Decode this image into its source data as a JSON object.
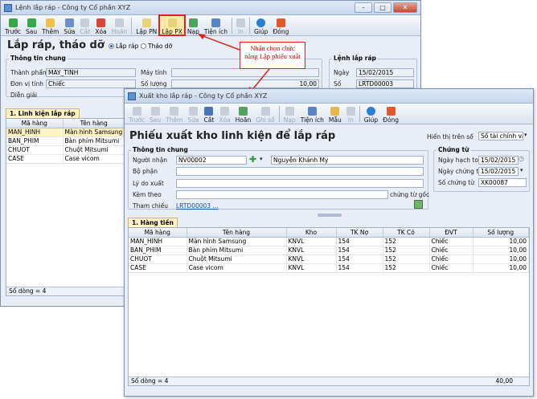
{
  "back": {
    "title": "Lệnh lắp ráp - Công ty Cổ phần XYZ",
    "toolbar": [
      "Trước",
      "Sau",
      "Thêm",
      "Sửa",
      "Cắt",
      "Xóa",
      "Hoãn",
      "Lập PN",
      "Lập PX",
      "Nạp",
      "Tiện ích",
      "In",
      "Giúp",
      "Đóng"
    ],
    "heading": "Lắp ráp, tháo dỡ",
    "radio_assemble": "Lắp ráp",
    "radio_disassemble": "Tháo dỡ",
    "group_general": "Thông tin chung",
    "lbl_product": "Thành phẩm",
    "val_product": "MAY_TINH",
    "lbl_product_name": "Máy tính",
    "lbl_unit": "Đơn vị tính",
    "val_unit": "Chiếc",
    "lbl_qty": "Số lượng",
    "val_qty": "10,00",
    "lbl_desc": "Diễn giải",
    "group_order": "Lệnh lắp ráp",
    "lbl_date": "Ngày",
    "val_date": "15/02/2015",
    "lbl_no": "Số",
    "val_no": "LRTD00003",
    "tab": "1. Linh kiện lắp ráp",
    "col_code": "Mã hàng",
    "col_name": "Tên hàng",
    "rows": [
      [
        "MAN_HINH",
        "Màn hình Samsung"
      ],
      [
        "BAN_PHIM",
        "Bàn phím Mitsumi"
      ],
      [
        "CHUOT",
        "Chuột Mitsumi"
      ],
      [
        "CASE",
        "Case vicom"
      ]
    ],
    "footer": "Số dòng = 4"
  },
  "callout": "Nhấn chọn chức năng Lập phiếu xuất",
  "front": {
    "title": "Xuất kho lắp ráp - Công ty Cổ phần XYZ",
    "toolbar": [
      "Trước",
      "Sau",
      "Thêm",
      "Sửa",
      "Cắt",
      "Xóa",
      "Hoãn",
      "Ghi sổ",
      "Nạp",
      "Tiện ích",
      "Mẫu",
      "In",
      "Giúp",
      "Đóng"
    ],
    "heading": "Phiếu xuất kho linh kiện để lắp ráp",
    "lbl_show": "Hiển thị trên sổ",
    "val_show": "Sổ tài chính và quản trị",
    "group_general": "Thông tin chung",
    "lbl_receiver": "Người nhận",
    "val_receiver_code": "NV00002",
    "val_receiver_name": "Nguyễn Khánh My",
    "lbl_dept": "Bộ phận",
    "lbl_reason": "Lý do xuất",
    "lbl_attach": "Kèm theo",
    "lbl_original": "chứng từ gốc",
    "lbl_ref": "Tham chiếu",
    "val_ref": "LRTD00003 ...",
    "group_voucher": "Chứng từ",
    "lbl_post_date": "Ngày hạch toán",
    "val_post_date": "15/02/2015",
    "lbl_voucher_date": "Ngày chứng từ",
    "val_voucher_date": "15/02/2015",
    "lbl_voucher_no": "Số chứng từ",
    "val_voucher_no": "XK00087",
    "tab": "1. Hàng tiền",
    "columns": [
      "Mã hàng",
      "Tên hàng",
      "Kho",
      "TK Nợ",
      "TK Có",
      "ĐVT",
      "Số lượng"
    ],
    "rows": [
      [
        "MAN_HINH",
        "Màn hình Samsung",
        "KNVL",
        "154",
        "152",
        "Chiếc",
        "10,00"
      ],
      [
        "BAN_PHIM",
        "Bàn phím Mitsumi",
        "KNVL",
        "154",
        "152",
        "Chiếc",
        "10,00"
      ],
      [
        "CHUOT",
        "Chuột Mitsumi",
        "KNVL",
        "154",
        "152",
        "Chiếc",
        "10,00"
      ],
      [
        "CASE",
        "Case vicom",
        "KNVL",
        "154",
        "152",
        "Chiếc",
        "10,00"
      ]
    ],
    "footer": "Số dòng = 4",
    "total": "40,00"
  },
  "colors": {
    "accent": "#2a63b8",
    "highlight": "#d22222",
    "tab": "#fff2c5"
  }
}
